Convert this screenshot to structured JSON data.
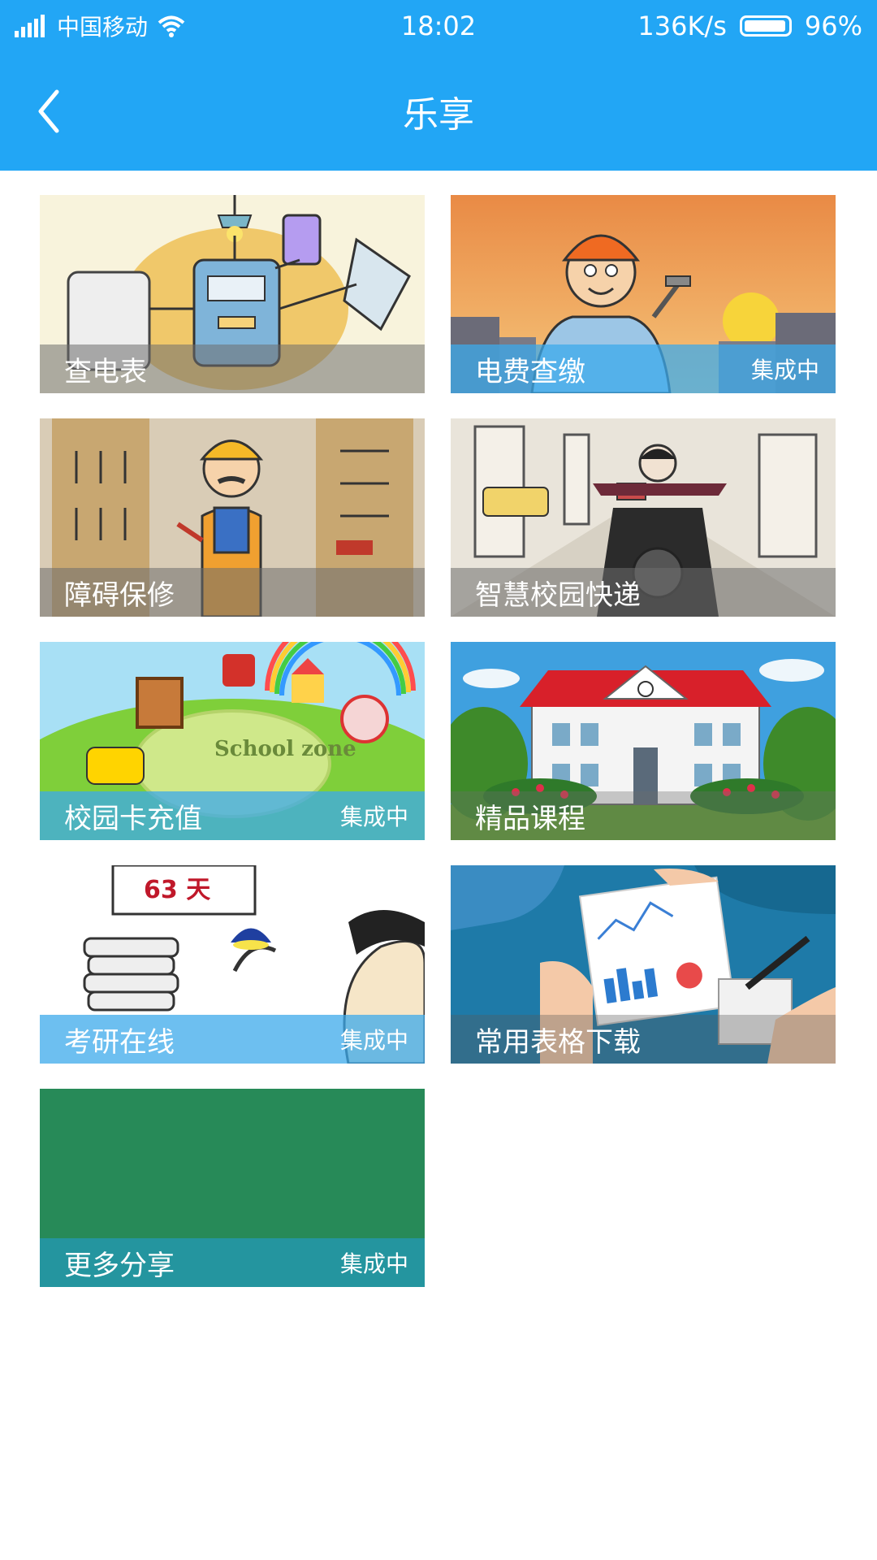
{
  "status_bar": {
    "carrier": "中国移动",
    "time": "18:02",
    "speed": "136K/s",
    "battery": "96%"
  },
  "header": {
    "title": "乐享",
    "back_icon": "chevron-left-icon"
  },
  "tiles": [
    {
      "label": "查电表",
      "badge": ""
    },
    {
      "label": "电费查缴",
      "badge": "集成中"
    },
    {
      "label": "障碍保修",
      "badge": ""
    },
    {
      "label": "智慧校园快递",
      "badge": ""
    },
    {
      "label": "校园卡充值",
      "badge": "集成中"
    },
    {
      "label": "精品课程",
      "badge": ""
    },
    {
      "label": "考研在线",
      "badge": "集成中"
    },
    {
      "label": "常用表格下载",
      "badge": ""
    },
    {
      "label": "更多分享",
      "badge": "集成中"
    }
  ],
  "artwork_text": {
    "school_zone": "School zone",
    "countdown": "63 天"
  },
  "colors": {
    "primary": "#22a6f5",
    "label_bar_translucent": "rgba(110,110,110,0.55)",
    "label_bar_blue": "rgba(60,170,235,0.75)",
    "more_tile_bg": "#278a58",
    "more_tile_bar": "#24959f"
  }
}
